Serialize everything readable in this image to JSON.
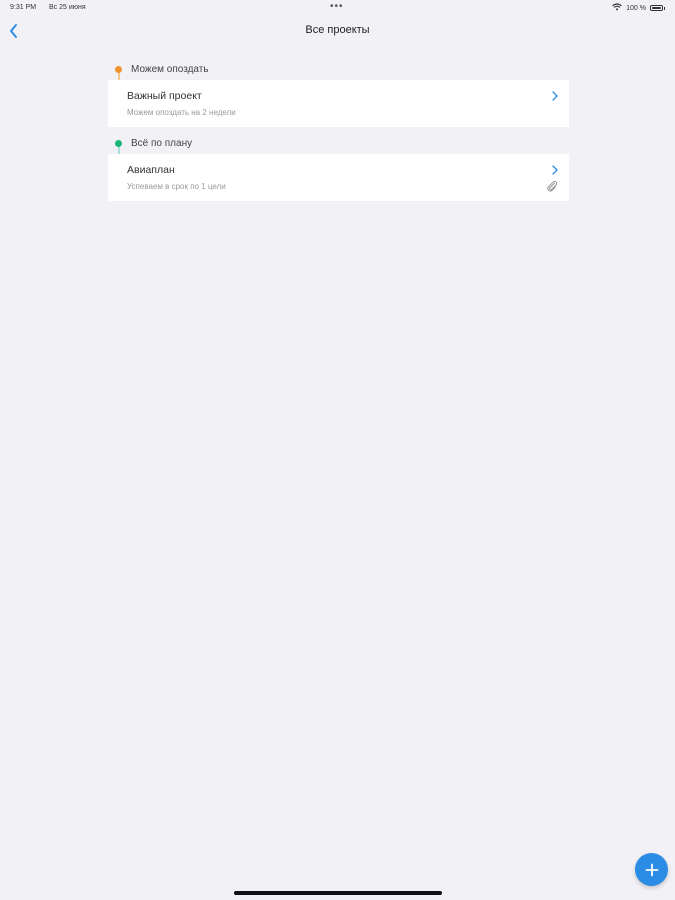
{
  "status_bar": {
    "time": "9:31 PM",
    "date": "Вс 25 июня",
    "dots": "•••",
    "battery": "100 %"
  },
  "nav": {
    "title": "Все проекты",
    "back_icon": "chevron-left-icon"
  },
  "groups": [
    {
      "title": "Можем опоздать",
      "color": "#f0932b",
      "line_color": "#f7c98a",
      "projects": [
        {
          "title": "Важный проект",
          "subtitle": "Можем опоздать на 2 недели",
          "has_attachment": false
        }
      ]
    },
    {
      "title": "Всё по плану",
      "color": "#1fb574",
      "line_color": "#a8dcd6",
      "projects": [
        {
          "title": "Авиаплан",
          "subtitle": "Успеваем в срок по 1 цели",
          "has_attachment": true
        }
      ]
    }
  ],
  "colors": {
    "accent": "#2b8ce6",
    "background": "#f2f2f6"
  },
  "fab": {
    "icon": "plus-icon"
  }
}
